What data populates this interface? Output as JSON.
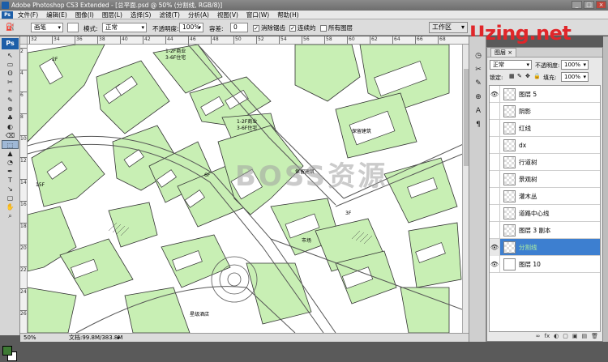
{
  "window": {
    "title": "Adobe Photoshop CS3 Extended - [总平面.psd @ 50% (分割线, RGB/8)]",
    "min_label": "_",
    "max_label": "□",
    "close_label": "×"
  },
  "menubar": {
    "logo": "Ps",
    "items": [
      "文件(F)",
      "编辑(E)",
      "图像(I)",
      "图层(L)",
      "选择(S)",
      "滤镜(T)",
      "分析(A)",
      "视图(V)",
      "窗口(W)",
      "帮助(H)"
    ]
  },
  "options": {
    "brush_preset": "画笔",
    "mode_label": "模式:",
    "mode_value": "正常",
    "opacity_label": "不透明度:",
    "opacity_value": "100%",
    "tolerance_label": "容差:",
    "tolerance_value": "0",
    "antialias_label": "消除锯齿",
    "contiguous_label": "连续的",
    "all_layers_label": "所有图层",
    "workspace_label": "工作区"
  },
  "toolbox": {
    "ps_label": "Ps",
    "tools": [
      "↖",
      "▭",
      "ʘ",
      "✂",
      "⌗",
      "✎",
      "⊕",
      "♣",
      "◐",
      "⌫",
      "⬚",
      "▲",
      "◔",
      "✒",
      "T",
      "↘",
      "▢",
      "✋",
      "⌕"
    ]
  },
  "rulers": {
    "top": [
      "32",
      "34",
      "36",
      "38",
      "40",
      "42",
      "44",
      "46",
      "48",
      "50",
      "52",
      "54",
      "56",
      "58",
      "60",
      "62",
      "64",
      "66",
      "68"
    ],
    "left": [
      "2",
      "4",
      "6",
      "8",
      "10",
      "12",
      "14",
      "16",
      "18",
      "20",
      "22",
      "24",
      "26"
    ]
  },
  "canvas": {
    "labels": [
      "1-2F商业",
      "3-6F住宅",
      "1-2F商业",
      "3-6F住宅",
      "保留建筑",
      "保留建筑",
      "市场",
      "星级酒店",
      "2F",
      "3F",
      "6F",
      "15F"
    ],
    "watermark": "BOSS资源"
  },
  "status": {
    "zoom": "50%",
    "doc_info": "文档:99.8M/383.8M",
    "arrow": "▸"
  },
  "brand": {
    "text": "Uzing.net"
  },
  "layers_panel": {
    "tab_label": "图层",
    "tab_close": "×",
    "blend_mode": "正常",
    "opacity_label": "不透明度:",
    "opacity_value": "100%",
    "lock_label": "锁定:",
    "fill_label": "填充:",
    "fill_value": "100%",
    "layers": [
      {
        "name": "图层 5",
        "visible": true,
        "selected": false
      },
      {
        "name": "阴影",
        "visible": false,
        "selected": false
      },
      {
        "name": "红线",
        "visible": false,
        "selected": false
      },
      {
        "name": "dx",
        "visible": false,
        "selected": false
      },
      {
        "name": "行道树",
        "visible": false,
        "selected": false
      },
      {
        "name": "景观树",
        "visible": false,
        "selected": false
      },
      {
        "name": "灌木丛",
        "visible": false,
        "selected": false
      },
      {
        "name": "道路中心线",
        "visible": false,
        "selected": false
      },
      {
        "name": "图层 3 副本",
        "visible": false,
        "selected": false
      },
      {
        "name": "分割线",
        "visible": true,
        "selected": true
      },
      {
        "name": "图层 10",
        "visible": true,
        "selected": false
      }
    ],
    "footer_icons": [
      "fx",
      "◐",
      "▢",
      "▣",
      "▤",
      "🗑"
    ]
  },
  "colors": {
    "plan_green": "#c8efb4",
    "accent_select": "#3d7fd0",
    "brand_red": "#e0262a"
  }
}
